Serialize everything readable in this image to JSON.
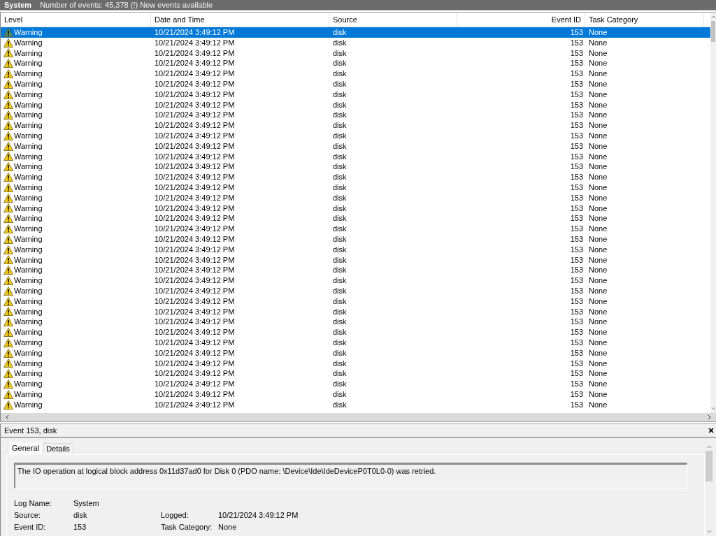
{
  "title_bar": {
    "log": "System",
    "info": "Number of events: 45,378 (!) New events available"
  },
  "table": {
    "columns": [
      {
        "label": "Level"
      },
      {
        "label": "Date and Time"
      },
      {
        "label": "Source"
      },
      {
        "label": "Event ID"
      },
      {
        "label": "Task Category"
      }
    ],
    "rows": [
      {
        "level": "Warning",
        "kind": "warning",
        "date": "10/21/2024 3:49:12 PM",
        "source": "disk",
        "event_id": "153",
        "category": "None",
        "selected": true
      },
      {
        "level": "Warning",
        "kind": "warning",
        "date": "10/21/2024 3:49:12 PM",
        "source": "disk",
        "event_id": "153",
        "category": "None",
        "selected": false
      },
      {
        "level": "Warning",
        "kind": "warning",
        "date": "10/21/2024 3:49:12 PM",
        "source": "disk",
        "event_id": "153",
        "category": "None",
        "selected": false
      },
      {
        "level": "Warning",
        "kind": "warning",
        "date": "10/21/2024 3:49:12 PM",
        "source": "disk",
        "event_id": "153",
        "category": "None",
        "selected": false
      },
      {
        "level": "Warning",
        "kind": "warning",
        "date": "10/21/2024 3:49:12 PM",
        "source": "disk",
        "event_id": "153",
        "category": "None",
        "selected": false
      },
      {
        "level": "Warning",
        "kind": "warning",
        "date": "10/21/2024 3:49:12 PM",
        "source": "disk",
        "event_id": "153",
        "category": "None",
        "selected": false
      },
      {
        "level": "Warning",
        "kind": "warning",
        "date": "10/21/2024 3:49:12 PM",
        "source": "disk",
        "event_id": "153",
        "category": "None",
        "selected": false
      },
      {
        "level": "Warning",
        "kind": "warning",
        "date": "10/21/2024 3:49:12 PM",
        "source": "disk",
        "event_id": "153",
        "category": "None",
        "selected": false
      },
      {
        "level": "Warning",
        "kind": "warning",
        "date": "10/21/2024 3:49:12 PM",
        "source": "disk",
        "event_id": "153",
        "category": "None",
        "selected": false
      },
      {
        "level": "Warning",
        "kind": "warning",
        "date": "10/21/2024 3:49:12 PM",
        "source": "disk",
        "event_id": "153",
        "category": "None",
        "selected": false
      },
      {
        "level": "Warning",
        "kind": "warning",
        "date": "10/21/2024 3:49:12 PM",
        "source": "disk",
        "event_id": "153",
        "category": "None",
        "selected": false
      },
      {
        "level": "Warning",
        "kind": "warning",
        "date": "10/21/2024 3:49:12 PM",
        "source": "disk",
        "event_id": "153",
        "category": "None",
        "selected": false
      },
      {
        "level": "Warning",
        "kind": "warning",
        "date": "10/21/2024 3:49:12 PM",
        "source": "disk",
        "event_id": "153",
        "category": "None",
        "selected": false
      },
      {
        "level": "Warning",
        "kind": "warning",
        "date": "10/21/2024 3:49:12 PM",
        "source": "disk",
        "event_id": "153",
        "category": "None",
        "selected": false
      },
      {
        "level": "Warning",
        "kind": "warning",
        "date": "10/21/2024 3:49:12 PM",
        "source": "disk",
        "event_id": "153",
        "category": "None",
        "selected": false
      },
      {
        "level": "Warning",
        "kind": "warning",
        "date": "10/21/2024 3:49:12 PM",
        "source": "disk",
        "event_id": "153",
        "category": "None",
        "selected": false
      },
      {
        "level": "Warning",
        "kind": "warning",
        "date": "10/21/2024 3:49:12 PM",
        "source": "disk",
        "event_id": "153",
        "category": "None",
        "selected": false
      },
      {
        "level": "Warning",
        "kind": "warning",
        "date": "10/21/2024 3:49:12 PM",
        "source": "disk",
        "event_id": "153",
        "category": "None",
        "selected": false
      },
      {
        "level": "Warning",
        "kind": "warning",
        "date": "10/21/2024 3:49:12 PM",
        "source": "disk",
        "event_id": "153",
        "category": "None",
        "selected": false
      },
      {
        "level": "Warning",
        "kind": "warning",
        "date": "10/21/2024 3:49:12 PM",
        "source": "disk",
        "event_id": "153",
        "category": "None",
        "selected": false
      },
      {
        "level": "Warning",
        "kind": "warning",
        "date": "10/21/2024 3:49:12 PM",
        "source": "disk",
        "event_id": "153",
        "category": "None",
        "selected": false
      },
      {
        "level": "Warning",
        "kind": "warning",
        "date": "10/21/2024 3:49:12 PM",
        "source": "disk",
        "event_id": "153",
        "category": "None",
        "selected": false
      },
      {
        "level": "Warning",
        "kind": "warning",
        "date": "10/21/2024 3:49:12 PM",
        "source": "disk",
        "event_id": "153",
        "category": "None",
        "selected": false
      },
      {
        "level": "Warning",
        "kind": "warning",
        "date": "10/21/2024 3:49:12 PM",
        "source": "disk",
        "event_id": "153",
        "category": "None",
        "selected": false
      },
      {
        "level": "Warning",
        "kind": "warning",
        "date": "10/21/2024 3:49:12 PM",
        "source": "disk",
        "event_id": "153",
        "category": "None",
        "selected": false
      },
      {
        "level": "Warning",
        "kind": "warning",
        "date": "10/21/2024 3:49:12 PM",
        "source": "disk",
        "event_id": "153",
        "category": "None",
        "selected": false
      },
      {
        "level": "Warning",
        "kind": "warning",
        "date": "10/21/2024 3:49:12 PM",
        "source": "disk",
        "event_id": "153",
        "category": "None",
        "selected": false
      },
      {
        "level": "Warning",
        "kind": "warning",
        "date": "10/21/2024 3:49:12 PM",
        "source": "disk",
        "event_id": "153",
        "category": "None",
        "selected": false
      },
      {
        "level": "Warning",
        "kind": "warning",
        "date": "10/21/2024 3:49:12 PM",
        "source": "disk",
        "event_id": "153",
        "category": "None",
        "selected": false
      },
      {
        "level": "Warning",
        "kind": "warning",
        "date": "10/21/2024 3:49:12 PM",
        "source": "disk",
        "event_id": "153",
        "category": "None",
        "selected": false
      },
      {
        "level": "Warning",
        "kind": "warning",
        "date": "10/21/2024 3:49:12 PM",
        "source": "disk",
        "event_id": "153",
        "category": "None",
        "selected": false
      },
      {
        "level": "Warning",
        "kind": "warning",
        "date": "10/21/2024 3:49:12 PM",
        "source": "disk",
        "event_id": "153",
        "category": "None",
        "selected": false
      },
      {
        "level": "Warning",
        "kind": "warning",
        "date": "10/21/2024 3:49:12 PM",
        "source": "disk",
        "event_id": "153",
        "category": "None",
        "selected": false
      },
      {
        "level": "Warning",
        "kind": "warning",
        "date": "10/21/2024 3:49:12 PM",
        "source": "disk",
        "event_id": "153",
        "category": "None",
        "selected": false
      },
      {
        "level": "Warning",
        "kind": "warning",
        "date": "10/21/2024 3:49:12 PM",
        "source": "disk",
        "event_id": "153",
        "category": "None",
        "selected": false
      },
      {
        "level": "Warning",
        "kind": "warning",
        "date": "10/21/2024 3:49:12 PM",
        "source": "disk",
        "event_id": "153",
        "category": "None",
        "selected": false
      },
      {
        "level": "Warning",
        "kind": "warning",
        "date": "10/21/2024 3:49:12 PM",
        "source": "disk",
        "event_id": "153",
        "category": "None",
        "selected": false
      }
    ]
  },
  "details": {
    "title": "Event 153, disk",
    "tabs": [
      {
        "label": "General",
        "selected": true
      },
      {
        "label": "Details",
        "selected": false
      }
    ],
    "message": "The IO operation at logical block address 0x11d37ad0 for Disk 0 (PDO name: \\Device\\Ide\\IdeDeviceP0T0L0-0) was retried.",
    "fields": [
      [
        {
          "label": "Log Name:",
          "value": "System"
        }
      ],
      [
        {
          "label": "Source:",
          "value": "disk"
        },
        {
          "label": "Logged:",
          "value": "10/21/2024 3:49:12 PM"
        }
      ],
      [
        {
          "label": "Event ID:",
          "value": "153"
        },
        {
          "label": "Task Category:",
          "value": "None"
        }
      ]
    ]
  }
}
